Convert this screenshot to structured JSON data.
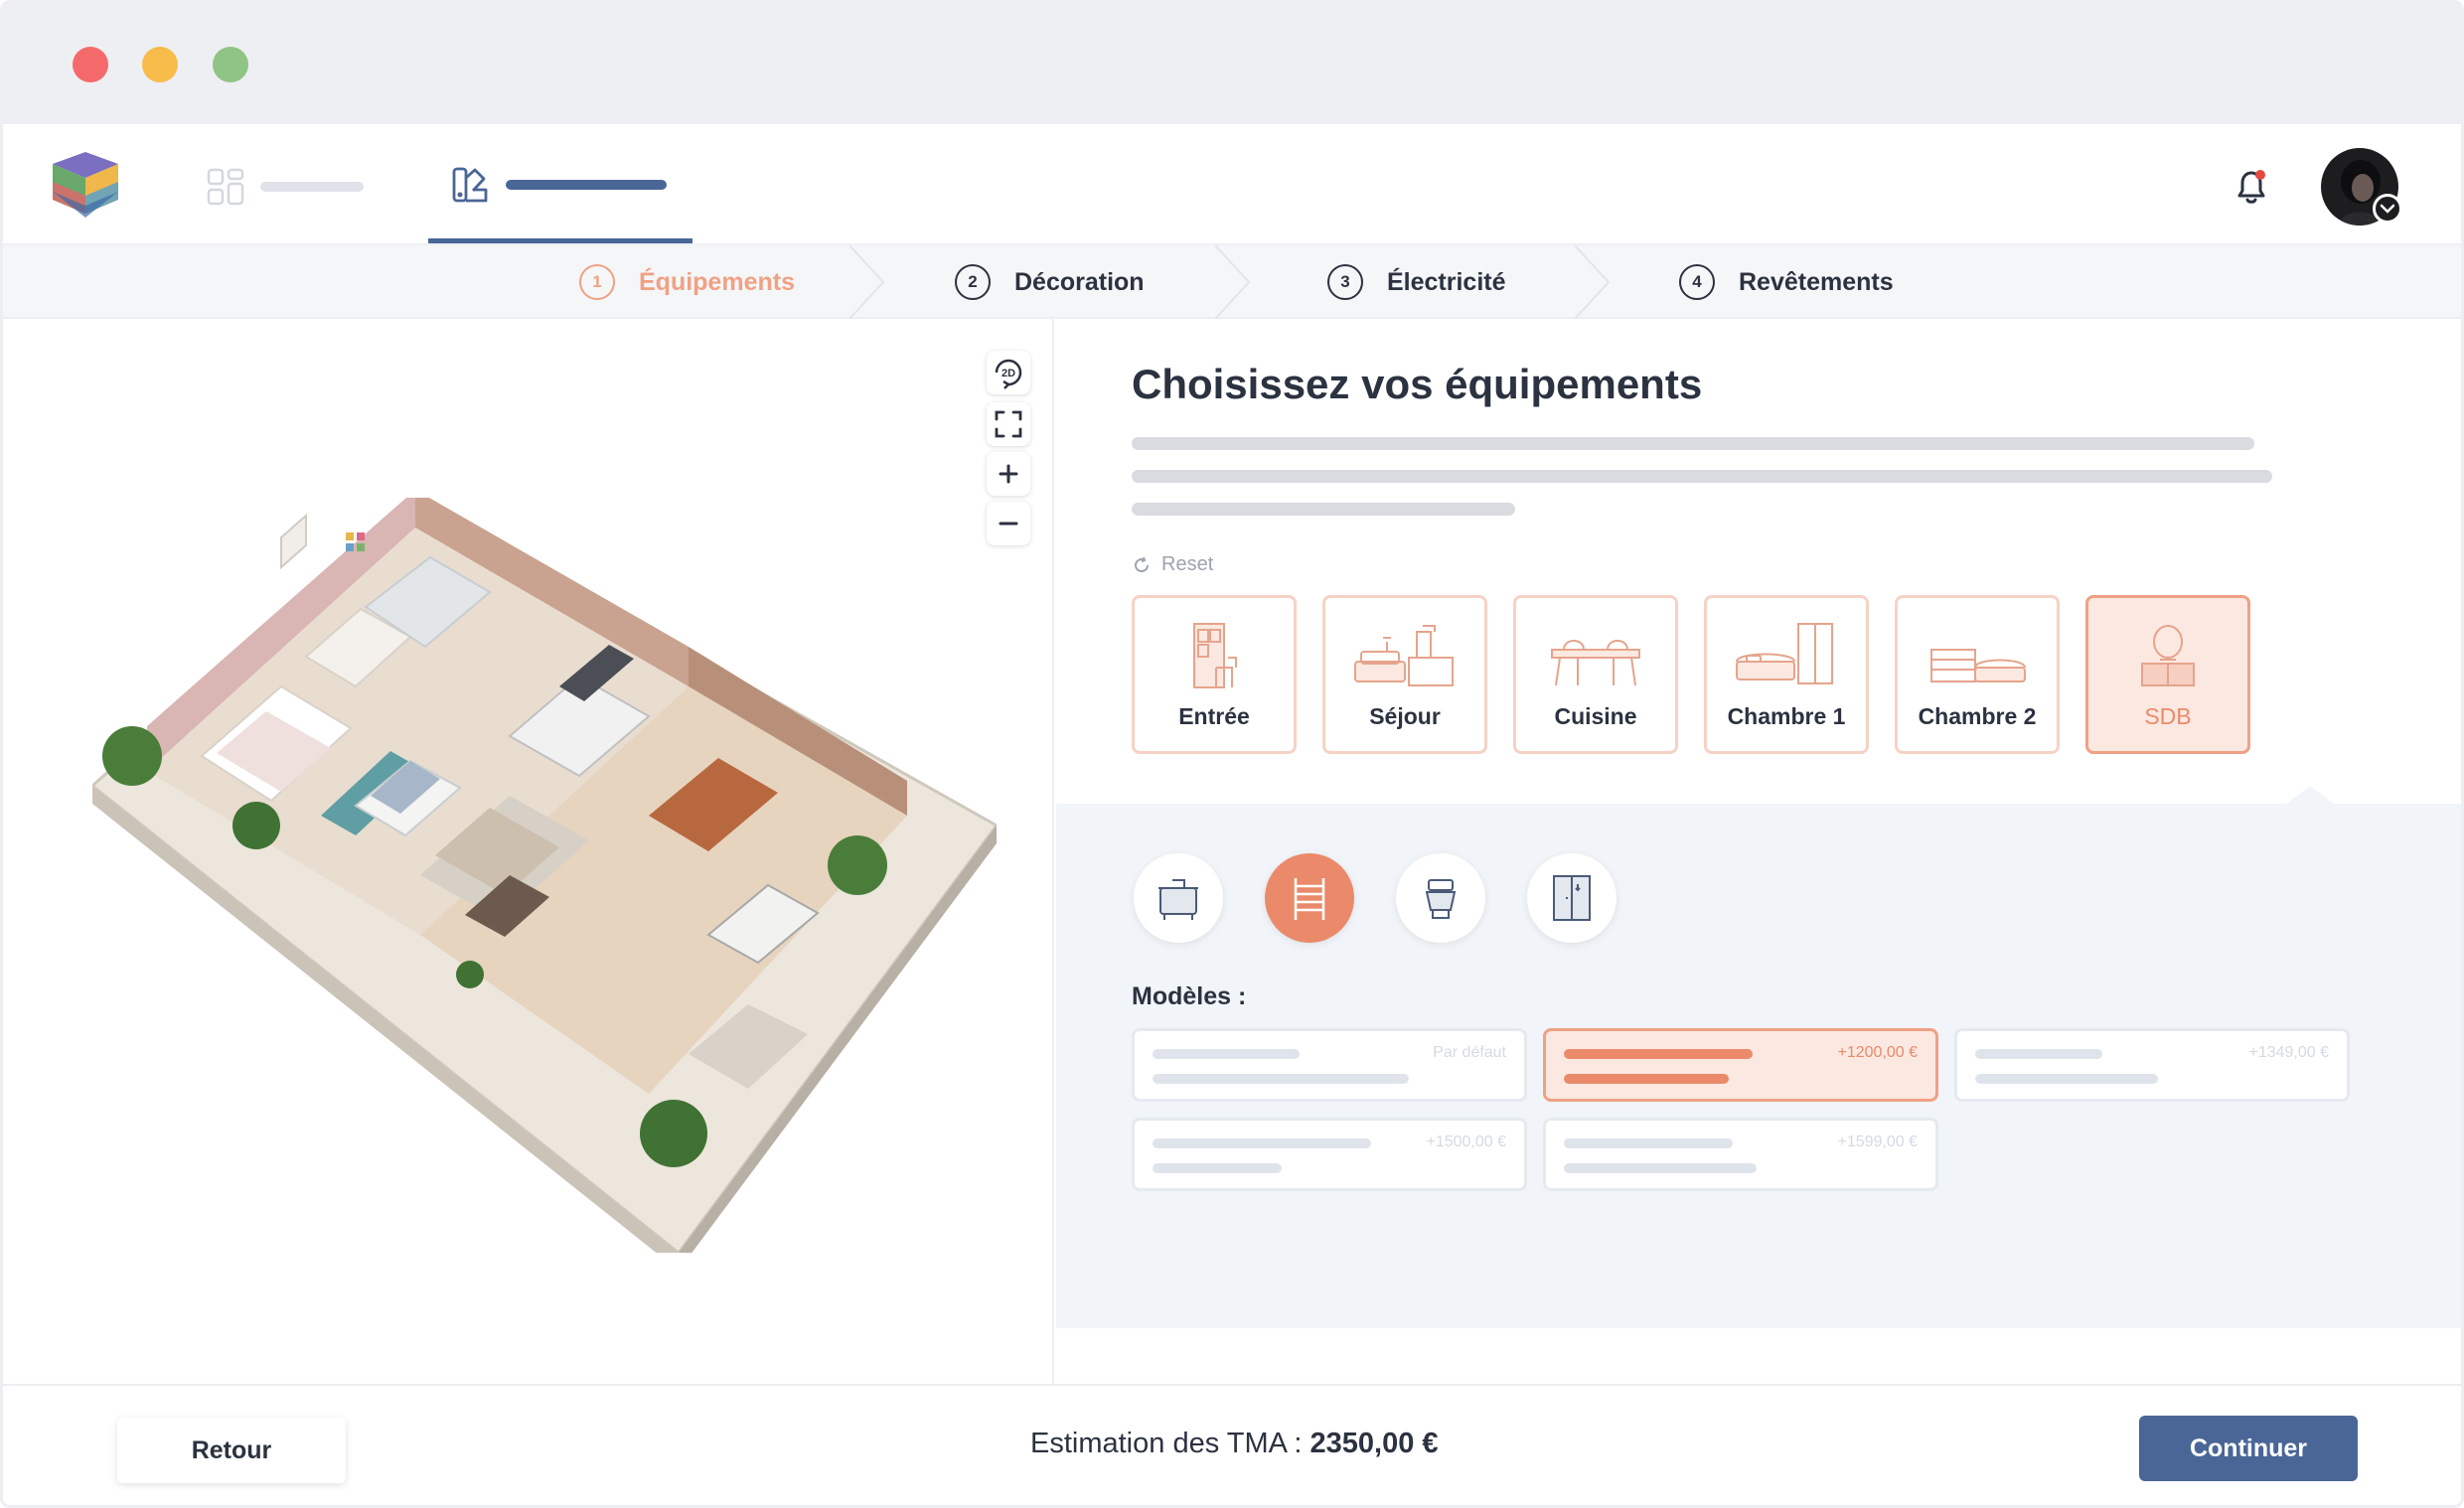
{
  "nav": {
    "items": [
      {
        "icon": "grid-icon",
        "active": false
      },
      {
        "icon": "swatch-icon",
        "active": true
      }
    ]
  },
  "steps": [
    {
      "number": "1",
      "label": "Équipements",
      "active": true
    },
    {
      "number": "2",
      "label": "Décoration",
      "active": false
    },
    {
      "number": "3",
      "label": "Électricité",
      "active": false
    },
    {
      "number": "4",
      "label": "Revêtements",
      "active": false
    }
  ],
  "viewer": {
    "toggle_label": "2D",
    "tools": [
      "rotate-2d-icon",
      "fullscreen-icon",
      "zoom-in-icon",
      "zoom-out-icon"
    ]
  },
  "panel": {
    "title": "Choisissez vos équipements",
    "reset_label": "Reset",
    "rooms": [
      {
        "label": "Entrée",
        "selected": false
      },
      {
        "label": "Séjour",
        "selected": false
      },
      {
        "label": "Cuisine",
        "selected": false
      },
      {
        "label": "Chambre 1",
        "selected": false
      },
      {
        "label": "Chambre 2",
        "selected": false
      },
      {
        "label": "SDB",
        "selected": true
      }
    ],
    "equipment": [
      {
        "icon": "vanity-icon",
        "selected": false
      },
      {
        "icon": "towel-radiator-icon",
        "selected": true
      },
      {
        "icon": "toilet-icon",
        "selected": false
      },
      {
        "icon": "shower-door-icon",
        "selected": false
      }
    ],
    "models_label": "Modèles :",
    "models": [
      {
        "price": "Par défaut",
        "selected": false
      },
      {
        "price": "+1200,00 €",
        "selected": true
      },
      {
        "price": "+1349,00 €",
        "selected": false
      },
      {
        "price": "+1500,00 €",
        "selected": false
      },
      {
        "price": "+1599,00 €",
        "selected": false
      }
    ]
  },
  "footer": {
    "back_label": "Retour",
    "estimate_label": "Estimation des TMA : ",
    "estimate_value": "2350,00 €",
    "continue_label": "Continuer"
  },
  "colors": {
    "primary": "#4a6697",
    "accent": "#ea8a6a",
    "accent_light": "#fbe8e1",
    "notification_dot": "#e5483f"
  }
}
